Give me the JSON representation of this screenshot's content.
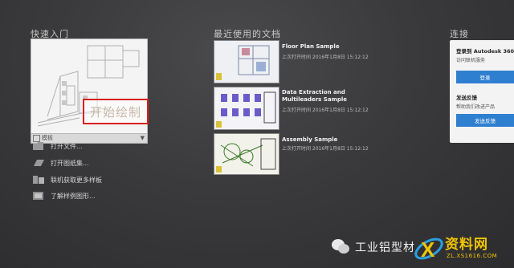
{
  "quick_start": {
    "title": "快速入门",
    "start_drawing": "开始绘制",
    "template_label": "模板",
    "items": [
      {
        "label": "打开文件...",
        "icon": "folder-icon"
      },
      {
        "label": "打开图纸集...",
        "icon": "sheet-set-icon"
      },
      {
        "label": "联机获取更多样板",
        "icon": "templates-icon"
      },
      {
        "label": "了解样例图形...",
        "icon": "sample-drawings-icon"
      }
    ]
  },
  "recent": {
    "title": "最近使用的文档",
    "docs": [
      {
        "name": "Floor Plan Sample",
        "meta": "上次打开时间 2016年1月8日 15:12:12"
      },
      {
        "name": "Data Extraction and Multileaders Sample",
        "meta": "上次打开时间 2016年1月8日 15:12:12"
      },
      {
        "name": "Assembly Sample",
        "meta": "上次打开时间 2016年1月8日 15:12:12"
      }
    ]
  },
  "connect": {
    "title": "连接",
    "login_head": "登录到 Autodesk 360",
    "login_sub": "访问联机服务",
    "login_btn": "登录",
    "feedback_head": "发送反馈",
    "feedback_sub": "帮助我们改进产品",
    "feedback_btn": "发送反馈"
  },
  "watermark": {
    "text": "工业铝型材",
    "brand": "资料网",
    "url": "ZL.XS1616.COM"
  }
}
